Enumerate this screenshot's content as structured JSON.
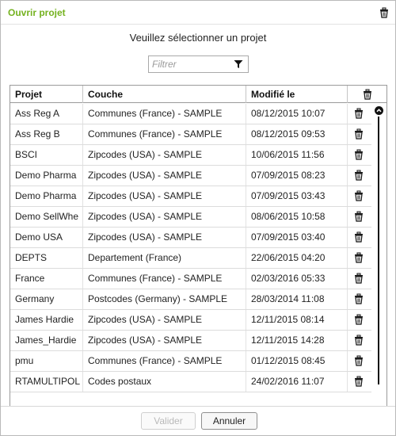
{
  "dialog": {
    "title": "Ouvrir projet",
    "prompt": "Veuillez sélectionner un projet"
  },
  "filter": {
    "placeholder": "Filtrer",
    "icon": "filter-icon"
  },
  "table": {
    "columns": [
      "Projet",
      "Couche",
      "Modifié le"
    ],
    "header_icon": "trash-icon",
    "rows": [
      {
        "projet": "Ass Reg A",
        "couche": "Communes (France) - SAMPLE",
        "modifie": "08/12/2015 10:07"
      },
      {
        "projet": "Ass Reg B",
        "couche": "Communes (France) - SAMPLE",
        "modifie": "08/12/2015 09:53"
      },
      {
        "projet": "BSCI",
        "couche": "Zipcodes (USA) - SAMPLE",
        "modifie": "10/06/2015 11:56"
      },
      {
        "projet": "Demo Pharma",
        "couche": "Zipcodes (USA) - SAMPLE",
        "modifie": "07/09/2015 08:23"
      },
      {
        "projet": "Demo Pharma",
        "couche": "Zipcodes (USA) - SAMPLE",
        "modifie": "07/09/2015 03:43"
      },
      {
        "projet": "Demo SellWhe",
        "couche": "Zipcodes (USA) - SAMPLE",
        "modifie": "08/06/2015 10:58"
      },
      {
        "projet": "Demo USA",
        "couche": "Zipcodes (USA) - SAMPLE",
        "modifie": "07/09/2015 03:40"
      },
      {
        "projet": "DEPTS",
        "couche": "Departement (France)",
        "modifie": "22/06/2015 04:20"
      },
      {
        "projet": "France",
        "couche": "Communes (France) - SAMPLE",
        "modifie": "02/03/2016 05:33"
      },
      {
        "projet": "Germany",
        "couche": "Postcodes (Germany) - SAMPLE",
        "modifie": "28/03/2014 11:08"
      },
      {
        "projet": "James Hardie",
        "couche": "Zipcodes (USA) - SAMPLE",
        "modifie": "12/11/2015 08:14"
      },
      {
        "projet": "James_Hardie",
        "couche": "Zipcodes (USA) - SAMPLE",
        "modifie": "12/11/2015 14:28"
      },
      {
        "projet": "pmu",
        "couche": "Communes (France) - SAMPLE",
        "modifie": "01/12/2015 08:45"
      },
      {
        "projet": "RTAMULTIPOL",
        "couche": "Codes postaux",
        "modifie": "24/02/2016 11:07"
      }
    ]
  },
  "footer": {
    "valider_label": "Valider",
    "annuler_label": "Annuler"
  },
  "colors": {
    "title": "#74b21f"
  }
}
